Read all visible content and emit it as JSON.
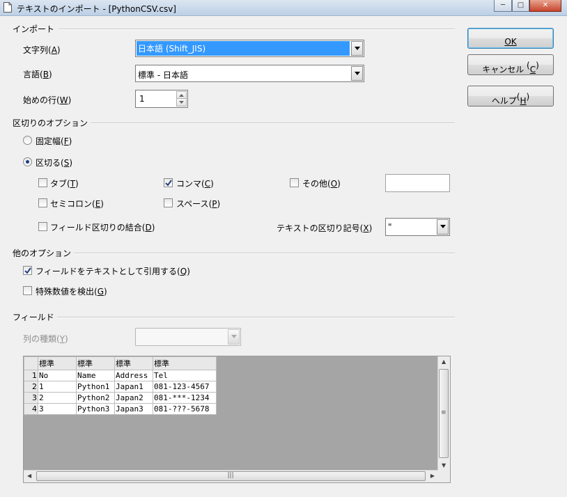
{
  "window": {
    "title": "テキストのインポート - [PythonCSV.csv]",
    "controls": [
      "─",
      "□",
      "✕"
    ]
  },
  "import_section": {
    "heading": "インポート",
    "charset": {
      "label": "文字列",
      "key": "A",
      "value": "日本語 (Shift_JIS)"
    },
    "language": {
      "label": "言語",
      "key": "B",
      "value": "標準 - 日本語"
    },
    "from_row": {
      "label": "始めの行",
      "key": "W",
      "value": "1"
    }
  },
  "separator_options": {
    "heading": "区切りのオプション",
    "fixed_width": {
      "label": "固定幅",
      "key": "F",
      "selected": false
    },
    "separated_by": {
      "label": "区切る",
      "key": "S",
      "selected": true
    },
    "tab": {
      "label": "タブ",
      "key": "T",
      "checked": false
    },
    "comma": {
      "label": "コンマ",
      "key": "C",
      "checked": true
    },
    "other": {
      "label": "その他",
      "key": "O",
      "checked": false,
      "value": ""
    },
    "semicolon": {
      "label": "セミコロン",
      "key": "E",
      "checked": false
    },
    "space": {
      "label": "スペース",
      "key": "P",
      "checked": false
    },
    "merge_delimiters": {
      "label": "フィールド区切りの結合",
      "key": "D",
      "checked": false
    },
    "text_delimiter": {
      "label": "テキストの区切り記号",
      "key": "X",
      "value": "\""
    }
  },
  "other_options": {
    "heading": "他のオプション",
    "quoted_as_text": {
      "label": "フィールドをテキストとして引用する",
      "key": "Q",
      "checked": true
    },
    "detect_special_numbers": {
      "label": "特殊数値を検出",
      "key": "G",
      "checked": false
    }
  },
  "fields": {
    "heading": "フィールド",
    "column_type": {
      "label": "列の種類",
      "key": "Y",
      "value": ""
    },
    "preview": {
      "column_headers": [
        "標準",
        "標準",
        "標準",
        "標準"
      ],
      "rows": [
        {
          "num": "1",
          "cells": [
            "No",
            "Name",
            "Address",
            "Tel"
          ]
        },
        {
          "num": "2",
          "cells": [
            "1",
            "Python1",
            "Japan1",
            "081-123-4567"
          ]
        },
        {
          "num": "3",
          "cells": [
            "2",
            "Python2",
            "Japan2",
            "081-***-1234"
          ]
        },
        {
          "num": "4",
          "cells": [
            "3",
            "Python3",
            "Japan3",
            "081-???-5678"
          ]
        }
      ]
    }
  },
  "buttons": {
    "ok": {
      "label": "OK",
      "key": "O"
    },
    "cancel": {
      "label": "キャンセル",
      "key": "C"
    },
    "help": {
      "label": "ヘルプ",
      "key": "H"
    }
  },
  "icons": {
    "title": "document-icon",
    "dropdown": "chevron-down-icon",
    "check": "check-icon"
  },
  "colors": {
    "selection": "#3399ff",
    "radio_dot": "#1d3f80",
    "preview_bg": "#a5a5a5"
  }
}
